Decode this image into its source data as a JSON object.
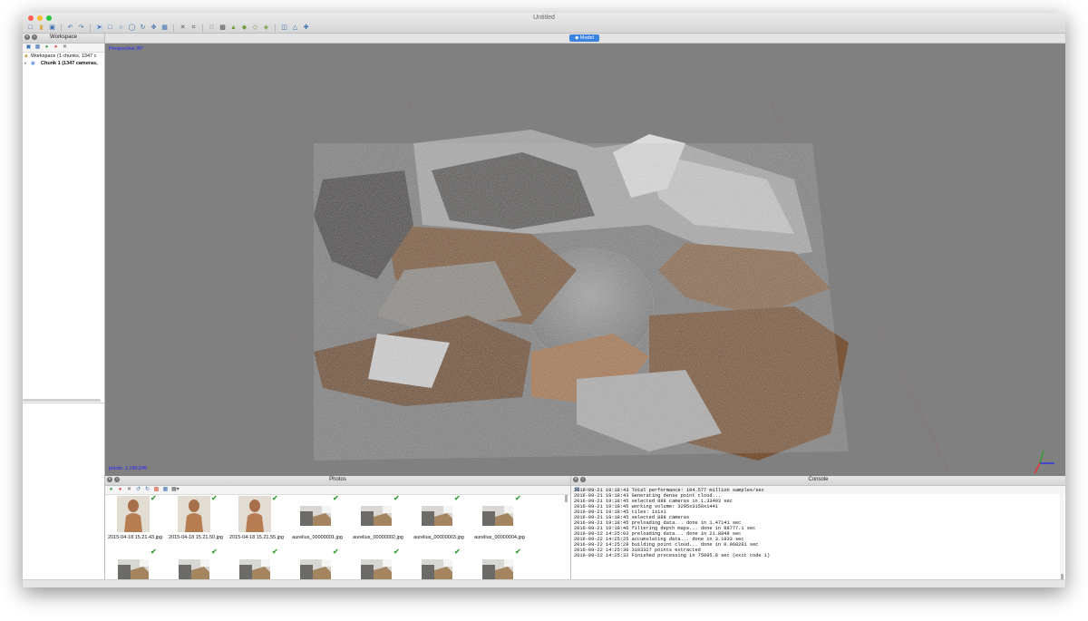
{
  "window": {
    "title": "Untitled",
    "traffic_lights": [
      "#fc5f56",
      "#fdbc2e",
      "#2ac840"
    ]
  },
  "toolbar": {
    "icons": [
      "new-icon",
      "open-icon",
      "save-icon",
      "undo-icon",
      "redo-icon",
      "navigation-icon",
      "rectangle-select-icon",
      "circle-select-icon",
      "free-select-icon",
      "rotate-object-icon",
      "move-object-icon",
      "resize-object-icon",
      "delete-icon",
      "crop-icon",
      "show-points-icon",
      "show-dense-cloud-icon",
      "show-model-icon",
      "show-texture-icon",
      "show-cameras-icon",
      "show-markers-icon",
      "reset-view-icon",
      "ortho-icon",
      "navigate-icon"
    ]
  },
  "workspace": {
    "title": "Workspace",
    "items": [
      {
        "label": "Workspace (1 chunks, 1347 c",
        "bold": false
      },
      {
        "label": "Chunk 1 (1347 cameras,",
        "bold": true
      }
    ]
  },
  "model_tab": {
    "label": "Model"
  },
  "viewport": {
    "projection_label": "Perspective 30°",
    "points_label": "points: 1,190,045"
  },
  "photos": {
    "title": "Photos",
    "items": [
      {
        "name": "2015-04-18 15.21.43.jpg",
        "kind": "statue",
        "checked": true
      },
      {
        "name": "2015-04-18 15.21.50.jpg",
        "kind": "statue",
        "checked": true
      },
      {
        "name": "2015-04-18 15.21.55.jpg",
        "kind": "statue",
        "checked": true
      },
      {
        "name": "aurelius_00000001.jpg",
        "kind": "wide",
        "checked": true
      },
      {
        "name": "aurelius_00000002.jpg",
        "kind": "wide",
        "checked": true
      },
      {
        "name": "aurelius_00000003.jpg",
        "kind": "wide",
        "checked": true
      },
      {
        "name": "aurelius_00000004.jpg",
        "kind": "wide",
        "checked": true
      },
      {
        "name": "",
        "kind": "wide",
        "checked": true
      },
      {
        "name": "",
        "kind": "wide",
        "checked": true
      },
      {
        "name": "",
        "kind": "wide",
        "checked": true
      },
      {
        "name": "",
        "kind": "wide",
        "checked": true
      },
      {
        "name": "",
        "kind": "wide",
        "checked": true
      },
      {
        "name": "",
        "kind": "wide",
        "checked": true
      },
      {
        "name": "",
        "kind": "wide",
        "checked": true
      }
    ]
  },
  "console": {
    "title": "Console",
    "lines": [
      "2016-09-21 19:18:43 Total performance: 104.577 million samples/sec",
      "2016-09-21 19:18:43 Generating dense point cloud...",
      "2016-09-21 19:18:45 selected 888 cameras in 1.33493 sec",
      "2016-09-21 19:18:45 working volume: 3205x3158x1441",
      "2016-09-21 19:18:45 tiles: 1x1x1",
      "2016-09-21 19:18:45 selected 888 cameras",
      "2016-09-21 19:18:45 preloading data... done in 1.47141 sec",
      "2016-09-21 19:18:46 filtering depth maps... done in 88777.1 sec",
      "2016-09-22 14:25:03 preloading data... done in 21.8848 sec",
      "2016-09-22 14:25:25 accumulating data... done in 3.1933 sec",
      "2016-09-22 14:25:28 building point cloud... done in 0.960201 sec",
      "2016-09-22 14:25:30 3103327 points extracted",
      "2016-09-22 14:25:32 Finished processing in 75095.8 sec (exit code 1)"
    ]
  },
  "colors": {
    "viewport_bg": "#808080",
    "label_blue": "#2424ff",
    "tab_blue": "#3b83e0",
    "check_green": "#3ba03b"
  }
}
